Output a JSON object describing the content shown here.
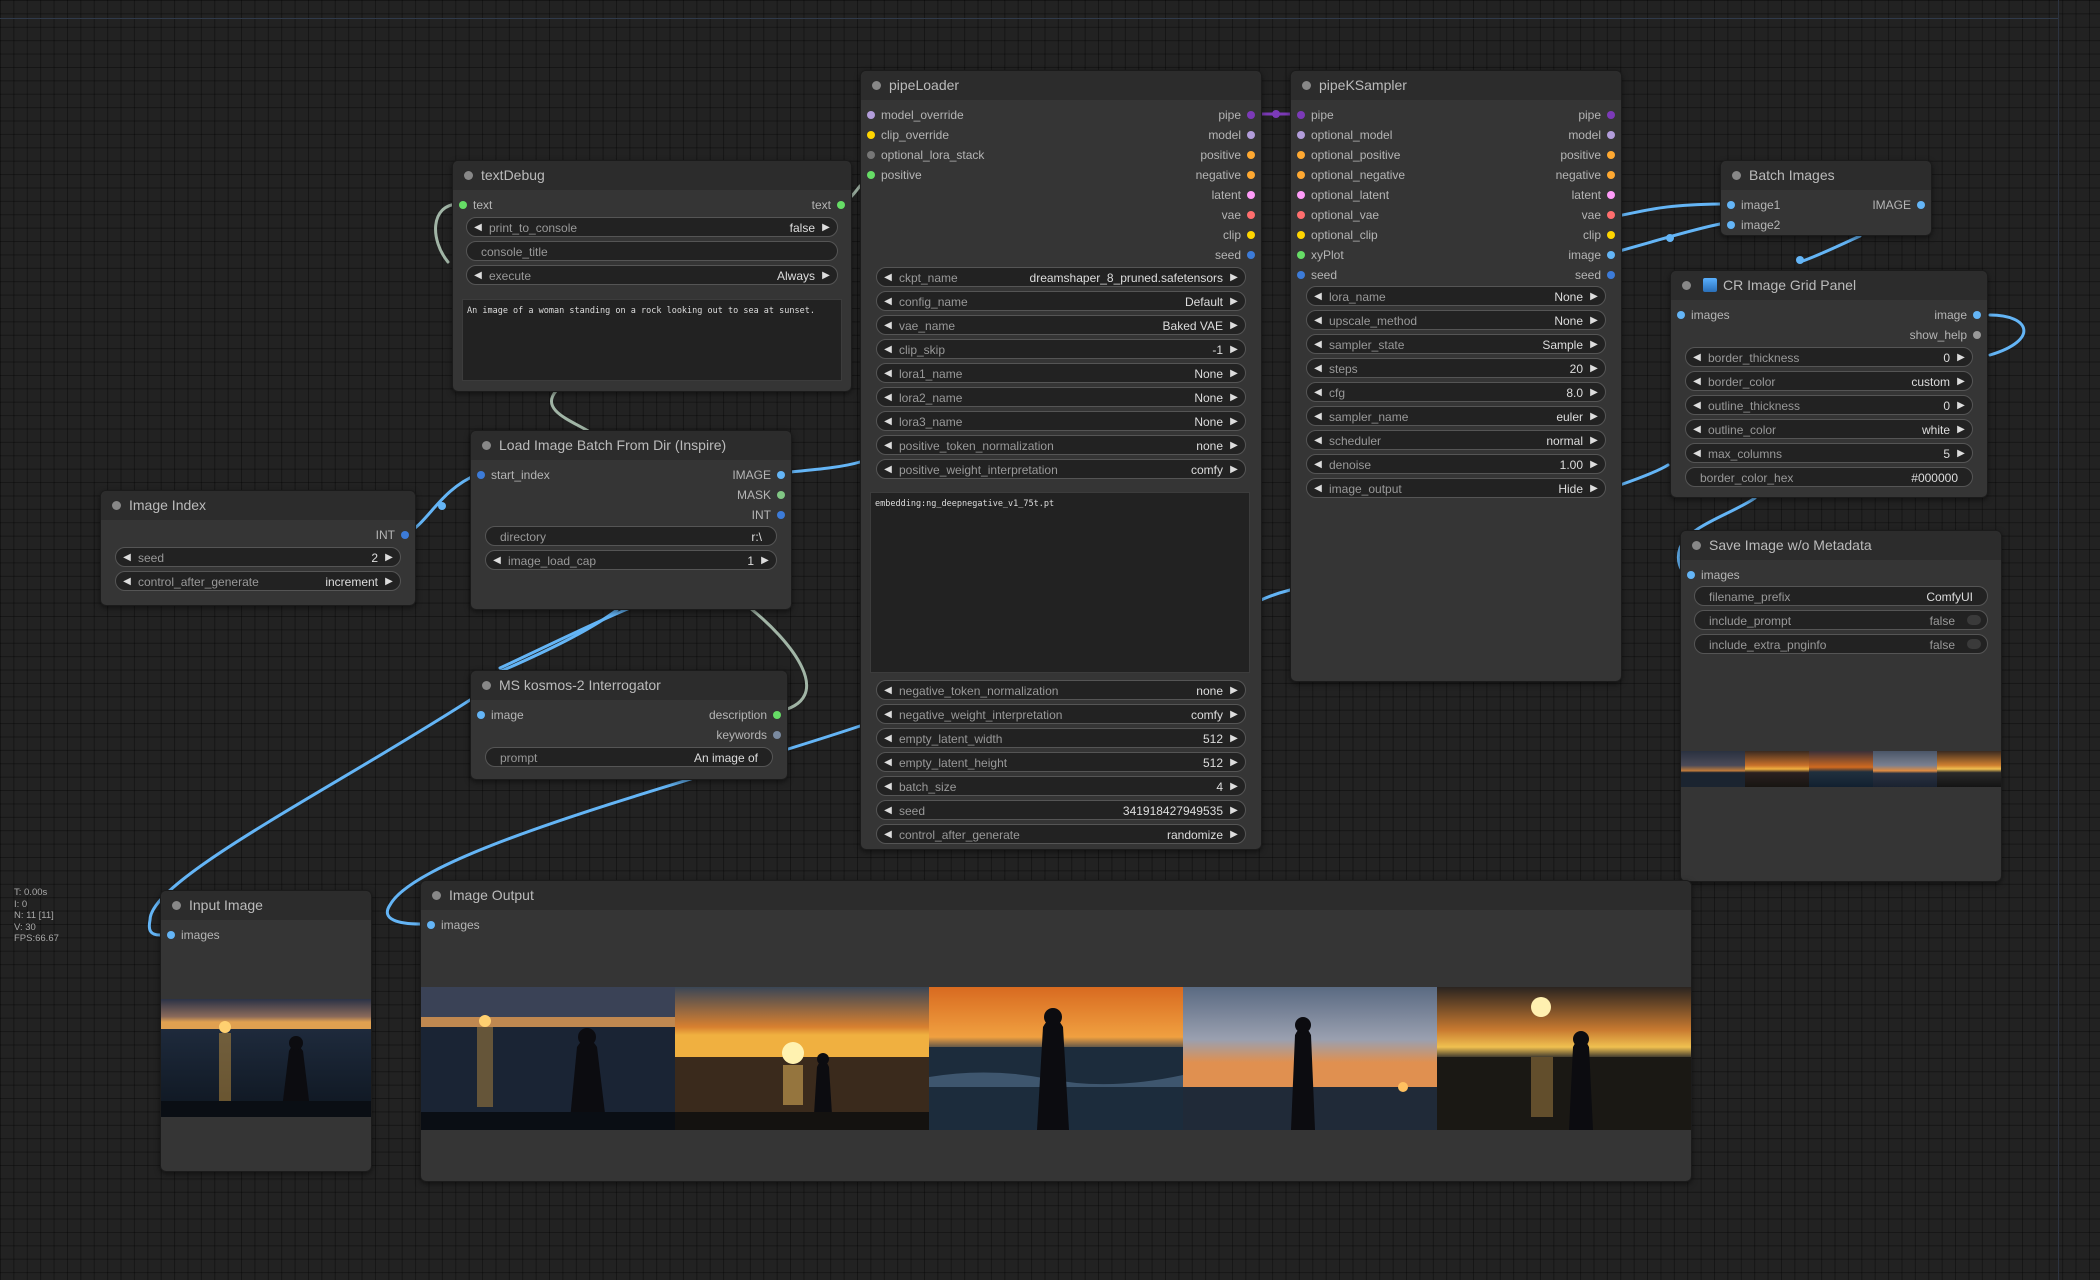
{
  "nodes": {
    "textDebug": {
      "title": "textDebug",
      "inputs": [
        "text"
      ],
      "outputs": [
        "text"
      ],
      "widgets": [
        {
          "label": "print_to_console",
          "value": "false"
        },
        {
          "label": "console_title",
          "value": ""
        },
        {
          "label": "execute",
          "value": "Always"
        }
      ],
      "text_value": "An image of a woman standing on a rock looking out to sea at sunset."
    },
    "pipeLoader": {
      "title": "pipeLoader",
      "inputs": [
        "model_override",
        "clip_override",
        "optional_lora_stack",
        "positive"
      ],
      "outputs": [
        "pipe",
        "model",
        "positive",
        "negative",
        "latent",
        "vae",
        "clip",
        "seed"
      ],
      "widgets_top": [
        {
          "label": "ckpt_name",
          "value": "dreamshaper_8_pruned.safetensors"
        },
        {
          "label": "config_name",
          "value": "Default"
        },
        {
          "label": "vae_name",
          "value": "Baked VAE"
        },
        {
          "label": "clip_skip",
          "value": "-1"
        },
        {
          "label": "lora1_name",
          "value": "None"
        },
        {
          "label": "lora2_name",
          "value": "None"
        },
        {
          "label": "lora3_name",
          "value": "None"
        },
        {
          "label": "positive_token_normalization",
          "value": "none"
        },
        {
          "label": "positive_weight_interpretation",
          "value": "comfy"
        }
      ],
      "negative_text": "embedding:ng_deepnegative_v1_75t.pt",
      "widgets_bottom": [
        {
          "label": "negative_token_normalization",
          "value": "none"
        },
        {
          "label": "negative_weight_interpretation",
          "value": "comfy"
        },
        {
          "label": "empty_latent_width",
          "value": "512"
        },
        {
          "label": "empty_latent_height",
          "value": "512"
        },
        {
          "label": "batch_size",
          "value": "4"
        },
        {
          "label": "seed",
          "value": "341918427949535"
        },
        {
          "label": "control_after_generate",
          "value": "randomize"
        }
      ]
    },
    "pipeKSampler": {
      "title": "pipeKSampler",
      "inputs": [
        "pipe",
        "optional_model",
        "optional_positive",
        "optional_negative",
        "optional_latent",
        "optional_vae",
        "optional_clip",
        "xyPlot",
        "seed"
      ],
      "outputs": [
        "pipe",
        "model",
        "positive",
        "negative",
        "latent",
        "vae",
        "clip",
        "image",
        "seed"
      ],
      "widgets": [
        {
          "label": "lora_name",
          "value": "None"
        },
        {
          "label": "upscale_method",
          "value": "None"
        },
        {
          "label": "sampler_state",
          "value": "Sample"
        },
        {
          "label": "steps",
          "value": "20"
        },
        {
          "label": "cfg",
          "value": "8.0"
        },
        {
          "label": "sampler_name",
          "value": "euler"
        },
        {
          "label": "scheduler",
          "value": "normal"
        },
        {
          "label": "denoise",
          "value": "1.00"
        },
        {
          "label": "image_output",
          "value": "Hide"
        }
      ]
    },
    "batchImages": {
      "title": "Batch Images",
      "inputs": [
        "image1",
        "image2"
      ],
      "outputs": [
        "IMAGE"
      ]
    },
    "crGrid": {
      "title": "CR Image Grid Panel",
      "inputs": [
        "images"
      ],
      "outputs": [
        "image",
        "show_help"
      ],
      "widgets": [
        {
          "label": "border_thickness",
          "value": "0"
        },
        {
          "label": "border_color",
          "value": "custom"
        },
        {
          "label": "outline_thickness",
          "value": "0"
        },
        {
          "label": "outline_color",
          "value": "white"
        },
        {
          "label": "max_columns",
          "value": "5"
        },
        {
          "label": "border_color_hex",
          "value": "#000000"
        }
      ]
    },
    "saveImage": {
      "title": "Save Image w/o Metadata",
      "inputs": [
        "images"
      ],
      "widgets": [
        {
          "label": "filename_prefix",
          "value": "ComfyUI"
        },
        {
          "label": "include_prompt",
          "value": "false"
        },
        {
          "label": "include_extra_pnginfo",
          "value": "false"
        }
      ]
    },
    "imageIndex": {
      "title": "Image Index",
      "outputs": [
        "INT"
      ],
      "widgets": [
        {
          "label": "seed",
          "value": "2"
        },
        {
          "label": "control_after_generate",
          "value": "increment"
        }
      ]
    },
    "loadBatch": {
      "title": "Load Image Batch From Dir (Inspire)",
      "inputs": [
        "start_index"
      ],
      "outputs": [
        "IMAGE",
        "MASK",
        "INT"
      ],
      "widgets": [
        {
          "label": "directory",
          "value": "r:\\"
        },
        {
          "label": "image_load_cap",
          "value": "1"
        }
      ]
    },
    "kosmos": {
      "title": "MS kosmos-2 Interrogator",
      "inputs": [
        "image"
      ],
      "outputs": [
        "description",
        "keywords"
      ],
      "widgets": [
        {
          "label": "prompt",
          "value": "An image of"
        }
      ]
    },
    "inputImage": {
      "title": "Input Image",
      "inputs": [
        "images"
      ]
    },
    "imageOutput": {
      "title": "Image Output",
      "inputs": [
        "images"
      ]
    }
  },
  "stats": [
    "T: 0.00s",
    "I: 0",
    "N: 11 [11]",
    "V: 30",
    "FPS:66.67"
  ],
  "colors": {
    "background": "#222222",
    "node_body": "#353535",
    "node_title": "#2c2c2c",
    "wire_image": "#64b5f6",
    "wire_pipe": "#7c3ab8",
    "wire_string": "#a1b5a6"
  }
}
